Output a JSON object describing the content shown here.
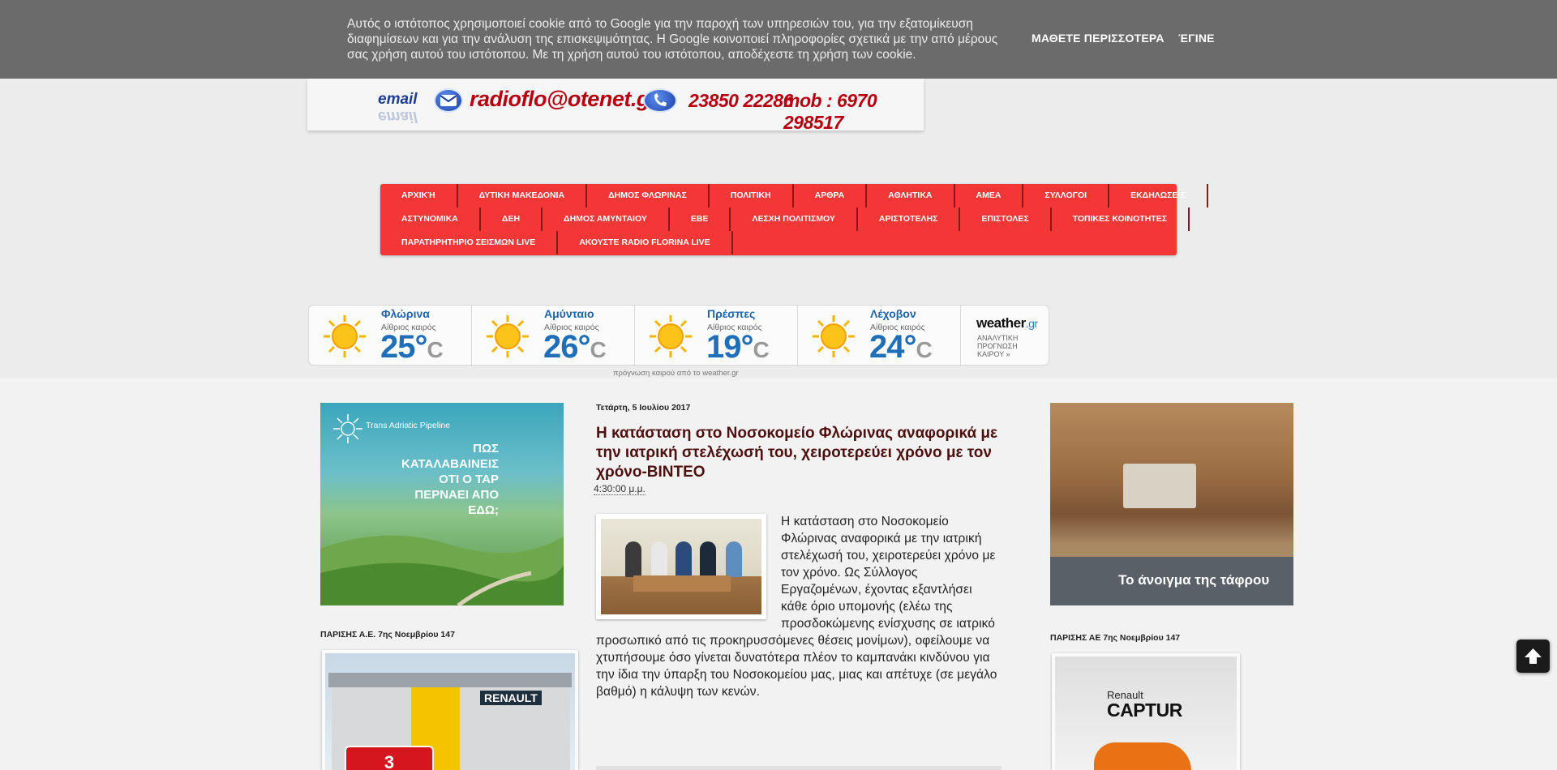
{
  "cookie_bar": {
    "text": "Αυτός ο ιστότοπος χρησιμοποιεί cookie από το Google για την παροχή των υπηρεσιών του, για την εξατομίκευση διαφημίσεων και για την ανάλυση της επισκεψιμότητας. Η Google κοινοποιεί πληροφορίες σχετικά με την από μέρους σας χρήση αυτού του ιστότοπου. Με τη χρήση αυτού του ιστότοπου, αποδέχεστε τη χρήση των cookie.",
    "learn_more": "ΜΑΘΕΤΕ ΠΕΡΙΣΣΟΤΕΡΑ",
    "ok": "ΈΓΙΝΕ"
  },
  "header": {
    "email_label": "email",
    "email": "radioflo@otenet.gr",
    "phone": "23850 22286",
    "mobile": "mob : 6970 298517"
  },
  "nav": {
    "row1": [
      "ΑΡΧΙΚΉ",
      "ΔΥΤΙΚΗ ΜΑΚΕΔΟΝΙΑ",
      "ΔΗΜΟΣ ΦΛΩΡΙΝΑΣ",
      "ΠΟΛΙΤΙΚΗ",
      "ΑΡΘΡΑ",
      "ΑΘΛΗΤΙΚΑ",
      "ΑΜΕΑ",
      "ΣΥΛΛΟΓΟΙ",
      "ΕΚΔΗΛΩΣΕΙΣ"
    ],
    "row2": [
      "ΑΣΤΥΝΟΜΙΚΑ",
      "ΔΕΗ",
      "ΔΗΜΟΣ ΑΜΥΝΤΑΙΟΥ",
      "ΕΒΕ",
      "ΛΕΣΧΗ ΠΟΛΙΤΙΣΜΟΥ",
      "ΑΡΙΣΤΟΤΕΛΗΣ",
      "ΕΠΙΣΤΟΛΕΣ",
      "ΤΟΠΙΚΕΣ ΚΟΙΝΟΤΗΤΕΣ"
    ],
    "row3": [
      "ΠΑΡΑΤΗΡΗΤΗΡΙΟ ΣΕΙΣΜΩΝ LIVE",
      "ΑΚΟΥΣΤΕ RADIO FLORINA LIVE"
    ]
  },
  "weather": {
    "cities": [
      {
        "city": "Φλώρινα",
        "condition": "Αίθριος καιρός",
        "temp": "25°",
        "unit": "C"
      },
      {
        "city": "Αμύνταιο",
        "condition": "Αίθριος καιρός",
        "temp": "26°",
        "unit": "C"
      },
      {
        "city": "Πρέσπες",
        "condition": "Αίθριος καιρός",
        "temp": "19°",
        "unit": "C"
      },
      {
        "city": "Λέχοβον",
        "condition": "Αίθριος καιρός",
        "temp": "24°",
        "unit": "C"
      }
    ],
    "logo": "weather",
    "logo_suffix": ".gr",
    "forecast_link": "ΑΝΑΛΥΤΙΚΗ ΠΡΟΓΝΩΣΗ ΚΑΙΡΟΥ »",
    "credit": "πρόγνωση καιρού από το weather.gr"
  },
  "left_sidebar": {
    "tap_ad": {
      "brand": "Trans Adriatic Pipeline",
      "text": "ΠΩΣ ΚΑΤΑΛΑΒΑΙΝΕΙΣ ΟΤΙ Ο TAP ΠΕΡΝΑΕΙ ΑΠΟ ΕΔΩ;"
    },
    "label": "ΠΑΡΙΣΗΣ Α.Ε. 7ης Νοεμβρίου 147",
    "renault_sign": "RENAULT",
    "badge": "3"
  },
  "post": {
    "date": "Τετάρτη, 5 Ιουλίου 2017",
    "title": "Η κατάσταση στο Νοσοκομείο Φλώρινας αναφορικά με την ιατρική στελέχωσή του, χειροτερεύει χρόνο με τον χρόνο-ΒΙΝΤΕΟ",
    "time": "4:30:00 μ.μ.",
    "body": "Η κατάσταση στο Νοσοκομείο Φλώρινας αναφορικά με την ιατρική στελέχωσή του, χειροτερεύει χρόνο με τον χρόνο. Ως Σύλλογος Εργαζομένων, έχοντας εξαντλήσει κάθε όριο υπομονής (ελέω της προσδοκώμενης ενίσχυσης σε ιατρικό προσωπικό από τις προκηρυσσόμενες θέσεις μονίμων), οφείλουμε να χτυπήσουμε όσο γίνεται δυνατότερα πλέον το καμπανάκι κινδύνου για την ίδια την ύπαρξη του Νοσοκομείου μας, μιας και απέτυχε (σε μεγάλο βαθμό)  η κάλυψη των κενών."
  },
  "right_sidebar": {
    "trench_ad_text": "Το άνοιγμα της τάφρου",
    "label": "ΠΑΡΙΣΗΣ ΑΕ 7ης Νοεμβρίου 147",
    "car_brand": "Renault",
    "car_model": "CAPTUR"
  },
  "colors": {
    "nav_bg": "#f33737",
    "cookie_bg": "#6b6b6b",
    "title_color": "#4e0f0f",
    "temp_color": "#1e6fb8"
  },
  "icons": {
    "envelope": "envelope-icon",
    "phone": "phone-icon",
    "sun": "sun-icon",
    "back_to_top": "arrow-up-icon"
  }
}
